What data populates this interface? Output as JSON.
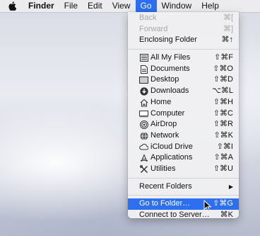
{
  "menubar": {
    "items": [
      "Finder",
      "File",
      "Edit",
      "View",
      "Go",
      "Window",
      "Help"
    ]
  },
  "go_menu": {
    "nav": [
      {
        "label": "Back",
        "shortcut": "⌘[",
        "disabled": true
      },
      {
        "label": "Forward",
        "shortcut": "⌘]",
        "disabled": true
      },
      {
        "label": "Enclosing Folder",
        "shortcut": "⌘↑",
        "disabled": false
      }
    ],
    "places": [
      {
        "label": "All My Files",
        "shortcut": "⇧⌘F",
        "icon": "all-files-icon"
      },
      {
        "label": "Documents",
        "shortcut": "⇧⌘O",
        "icon": "documents-icon"
      },
      {
        "label": "Desktop",
        "shortcut": "⇧⌘D",
        "icon": "desktop-icon"
      },
      {
        "label": "Downloads",
        "shortcut": "⌥⌘L",
        "icon": "downloads-icon"
      },
      {
        "label": "Home",
        "shortcut": "⇧⌘H",
        "icon": "home-icon"
      },
      {
        "label": "Computer",
        "shortcut": "⇧⌘C",
        "icon": "computer-icon"
      },
      {
        "label": "AirDrop",
        "shortcut": "⇧⌘R",
        "icon": "airdrop-icon"
      },
      {
        "label": "Network",
        "shortcut": "⇧⌘K",
        "icon": "network-icon"
      },
      {
        "label": "iCloud Drive",
        "shortcut": "⇧⌘I",
        "icon": "icloud-icon"
      },
      {
        "label": "Applications",
        "shortcut": "⇧⌘A",
        "icon": "applications-icon"
      },
      {
        "label": "Utilities",
        "shortcut": "⇧⌘U",
        "icon": "utilities-icon"
      }
    ],
    "recent_folders": {
      "label": "Recent Folders"
    },
    "goto": [
      {
        "label": "Go to Folder…",
        "shortcut": "⇧⌘G",
        "highlighted": true
      },
      {
        "label": "Connect to Server…",
        "shortcut": "⌘K",
        "highlighted": false
      }
    ]
  },
  "colors": {
    "highlight": "#2c6ff0"
  }
}
